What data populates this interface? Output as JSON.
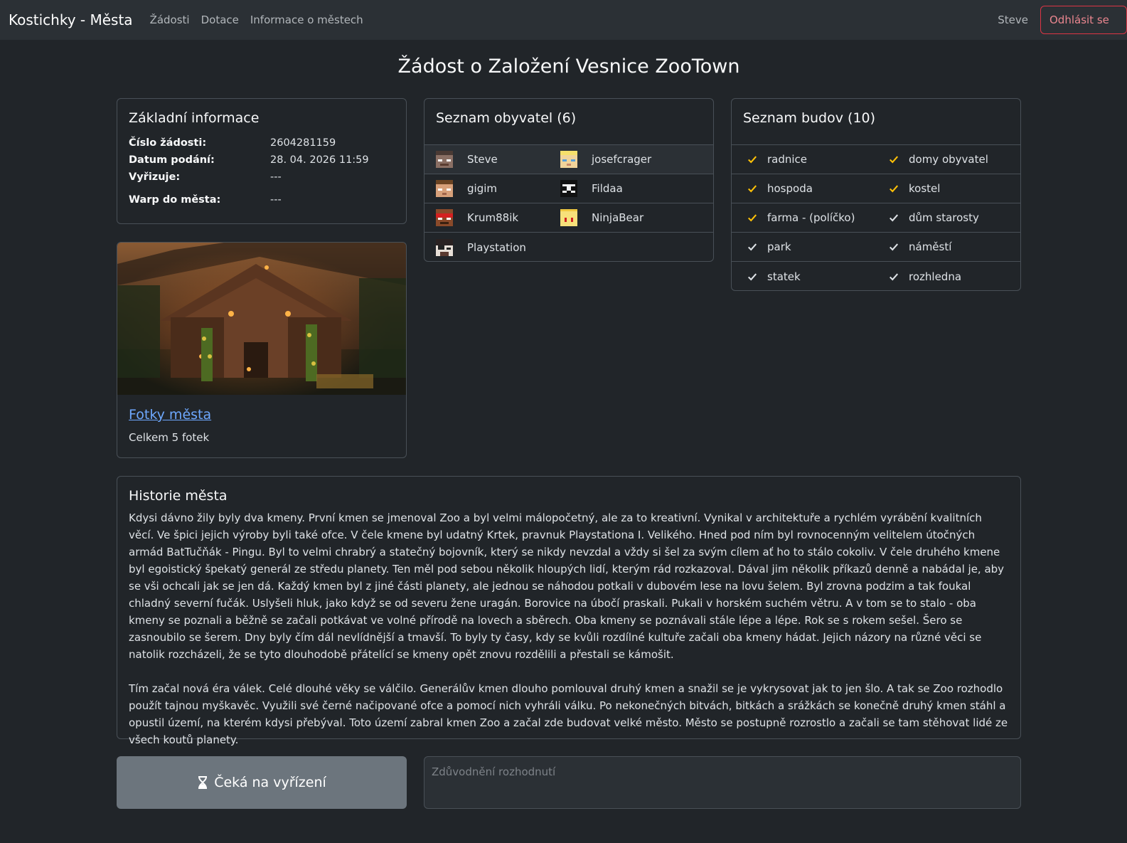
{
  "nav": {
    "brand": "Kostichky - Města",
    "links": [
      "Žádosti",
      "Dotace",
      "Informace o městech"
    ],
    "user": "Steve",
    "logout": "Odhlásit se"
  },
  "page": {
    "title": "Žádost o Založení Vesnice ZooTown"
  },
  "info": {
    "title": "Základní informace",
    "rows": [
      {
        "label": "Číslo žádosti:",
        "value": "2604281159"
      },
      {
        "label": "Datum podání:",
        "value": "28. 04. 2026 11:59"
      },
      {
        "label": "Vyřizuje:",
        "value": "---"
      },
      {
        "label": "Warp do města:",
        "value": "---"
      }
    ]
  },
  "photos": {
    "link": "Fotky města",
    "count": "Celkem 5 fotek"
  },
  "residents": {
    "title": "Seznam obyvatel (6)",
    "items": [
      {
        "name": "Steve",
        "avatar": "steve-avatar"
      },
      {
        "name": "josefcrager",
        "avatar": "blond-avatar"
      },
      {
        "name": "gigim",
        "avatar": "brown-avatar"
      },
      {
        "name": "Fildaa",
        "avatar": "panda-avatar"
      },
      {
        "name": "Krum88ik",
        "avatar": "red-headband-avatar"
      },
      {
        "name": "NinjaBear",
        "avatar": "yellow-avatar"
      },
      {
        "name": "Playstation",
        "avatar": "dark-avatar"
      }
    ]
  },
  "buildings": {
    "title": "Seznam budov (10)",
    "items": [
      {
        "name": "radnice",
        "status": "warning",
        "color": "#ffc107"
      },
      {
        "name": "domy obyvatel",
        "status": "warning",
        "color": "#ffc107"
      },
      {
        "name": "hospoda",
        "status": "warning",
        "color": "#ffc107"
      },
      {
        "name": "kostel",
        "status": "warning",
        "color": "#ffc107"
      },
      {
        "name": "farma - (políčko)",
        "status": "warning",
        "color": "#ffc107"
      },
      {
        "name": "dům starosty",
        "status": "done",
        "color": "#dee2e6"
      },
      {
        "name": "park",
        "status": "done",
        "color": "#dee2e6"
      },
      {
        "name": "náměstí",
        "status": "done",
        "color": "#dee2e6"
      },
      {
        "name": "statek",
        "status": "done",
        "color": "#dee2e6"
      },
      {
        "name": "rozhledna",
        "status": "done",
        "color": "#dee2e6"
      }
    ]
  },
  "history": {
    "title": "Historie města",
    "paragraphs": [
      "Kdysi dávno žily byly dva kmeny. První kmen se jmenoval Zoo a byl velmi málopočetný, ale za to kreativní. Vynikal v architektuře a rychlém vyrábění kvalitních věcí. Ve špici jejich výroby byli také ofce. V čele kmene byl udatný Krtek, pravnuk Playstationa I. Velikého. Hned pod ním byl rovnocenným velitelem útočných armád BatTučňák - Pingu. Byl to velmi chrabrý a statečný bojovník, který se nikdy nevzdal a vždy si šel za svým cílem ať ho to stálo cokoliv. V čele druhého kmene byl egoistický špekatý generál ze středu planety. Ten měl pod sebou několik hloupých lidí, kterým rád rozkazoval. Dával jim několik příkazů denně a nabádal je, aby se vši ochcali jak se jen dá. Každý kmen byl z jiné části planety, ale jednou se náhodou potkali v dubovém lese na lovu šelem. Byl zrovna podzim a tak foukal chladný severní fučák. Uslyšeli hluk, jako když se od severu žene uragán. Borovice na úbočí praskali. Pukali v horském suchém větru. A v tom se to stalo - oba kmeny se poznali a běžně se začali potkávat ve volné přírodě na lovech a sběrech. Oba kmeny se poznávali stále lépe a lépe. Rok se s rokem sešel. Šero se zasnoubilo se šerem. Dny byly čím dál nevlídnější a tmavší. To byly ty časy, kdy se kvůli rozdílné kultuře začali oba kmeny hádat. Jejich názory na různé věci se natolik rozcházeli, že se tyto dlouhodobě přátelící se kmeny opět znovu rozdělili a přestali se kámošit.",
      "Tím začal nová éra válek. Celé dlouhé věky se válčilo. Generálův kmen dlouho pomlouval druhý kmen a snažil se je vykrysovat jak to jen šlo. A tak se Zoo rozhodlo použít tajnou myškavěc. Využili své černé načipované ofce a pomocí nich vyhráli válku. Po nekonečných bitvách, bitkách a srážkách se konečně druhý kmen stáhl a opustil území, na kterém kdysi přebýval. Toto území zabral kmen Zoo a začal zde budovat velké město. Město se postupně rozrostlo a začali se tam stěhovat lidé ze všech koutů planety."
    ]
  },
  "status": {
    "label": "Čeká na vyřízení",
    "icon": "hourglass-icon"
  },
  "reason": {
    "placeholder": "Zdůvodnění rozhodnutí",
    "value": ""
  }
}
